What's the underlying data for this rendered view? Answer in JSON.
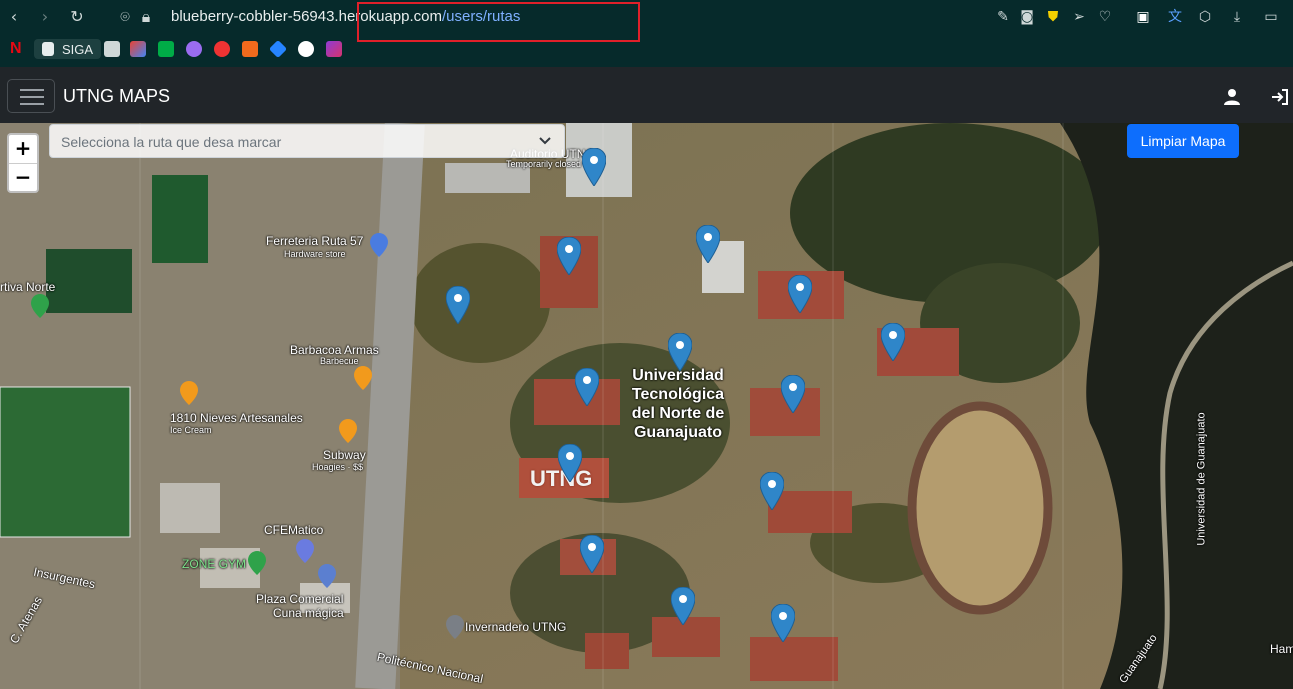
{
  "browser": {
    "url_host": "blueberry-cobbler-56943.herokuapp.com",
    "url_path": "/users/rutas",
    "bookmarks": [
      {
        "label": "SIGA"
      }
    ],
    "highlight_color": "#e0202a"
  },
  "navbar": {
    "brand": "UTNG MAPS",
    "user_icon": "user-icon",
    "login_icon": "sign-in-icon"
  },
  "map": {
    "zoom_in": "+",
    "zoom_out": "−",
    "route_select_placeholder": "Selecciona la ruta que desa marcar",
    "clear_button": "Limpiar Mapa",
    "accent": "#0d6efd",
    "marker_color": "#2f86c9",
    "labels": {
      "ferreteria": "Ferreteria Ruta 57",
      "ferreteria_sub": "Hardware store",
      "barbacoa": "Barbacoa Armas",
      "barbacoa_sub": "Barbecue",
      "nieves": "1810 Nieves Artesanales",
      "nieves_sub": "Ice Cream",
      "subway": "Subway",
      "subway_sub": "Hoagies · $$",
      "cfe": "CFEMatico",
      "zone_gym": "ZONE GYM",
      "plaza_1": "Plaza Comercial",
      "plaza_2": "Cuna mágica",
      "insurgentes": "Insurgentes",
      "atenas": "C. Atenas",
      "invernadero": "Invernadero UTNG",
      "politecnico": "Politécnico Nacional",
      "auditorio": "Auditorio UTNG",
      "auditorio_sub": "Temporarily closed",
      "uni_1": "Universidad",
      "uni_2": "Tecnológica",
      "uni_3": "del Norte de",
      "uni_4": "Guanajuato",
      "utng_sign": "UTNG",
      "ruta_norte": "rtiva Norte",
      "univ_gto": "Universidad de Guanajuato",
      "univ_gto_2": "Guanajuato",
      "ham": "Ham"
    }
  }
}
